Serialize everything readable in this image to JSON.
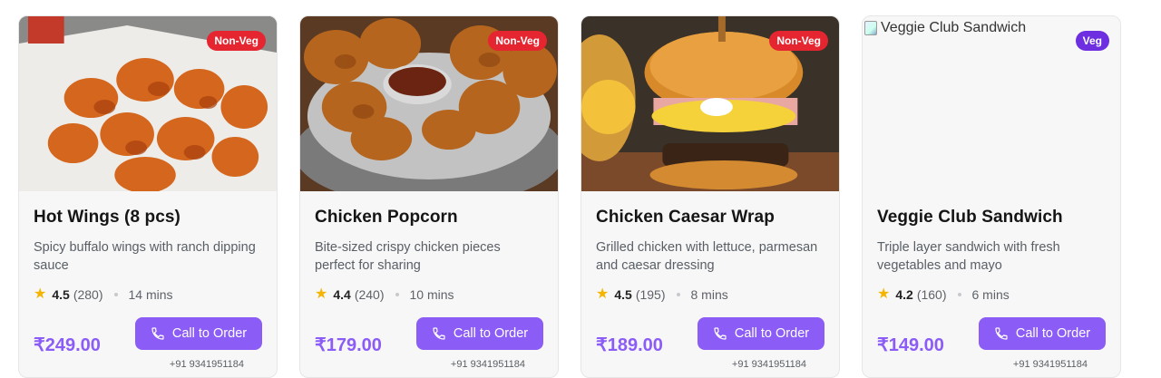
{
  "cards": [
    {
      "title": "Hot Wings (8 pcs)",
      "badge": "Non-Veg",
      "description": "Spicy buffalo wings with ranch dipping sauce",
      "rating": "4.5",
      "reviews": "(280)",
      "time": "14 mins",
      "price": "₹249.00",
      "cta": "Call to Order",
      "phone": "+91 9341951184",
      "image": "hot-wings-photo"
    },
    {
      "title": "Chicken Popcorn",
      "badge": "Non-Veg",
      "description": "Bite-sized crispy chicken pieces perfect for sharing",
      "rating": "4.4",
      "reviews": "(240)",
      "time": "10 mins",
      "price": "₹179.00",
      "cta": "Call to Order",
      "phone": "+91 9341951184",
      "image": "fried-chicken-photo"
    },
    {
      "title": "Chicken Caesar Wrap",
      "badge": "Non-Veg",
      "description": "Grilled chicken with lettuce, parmesan and caesar dressing",
      "rating": "4.5",
      "reviews": "(195)",
      "time": "8 mins",
      "price": "₹189.00",
      "cta": "Call to Order",
      "phone": "+91 9341951184",
      "image": "burger-photo"
    },
    {
      "title": "Veggie Club Sandwich",
      "badge": "Veg",
      "description": "Triple layer sandwich with fresh vegetables and mayo",
      "rating": "4.2",
      "reviews": "(160)",
      "time": "6 mins",
      "price": "₹149.00",
      "cta": "Call to Order",
      "phone": "+91 9341951184",
      "image_alt": "Veggie Club Sandwich"
    }
  ],
  "colors": {
    "accent": "#8b5cf6",
    "nonveg_badge": "#e5252f",
    "veg_badge": "#6d2fe0",
    "star": "#f4b400"
  }
}
